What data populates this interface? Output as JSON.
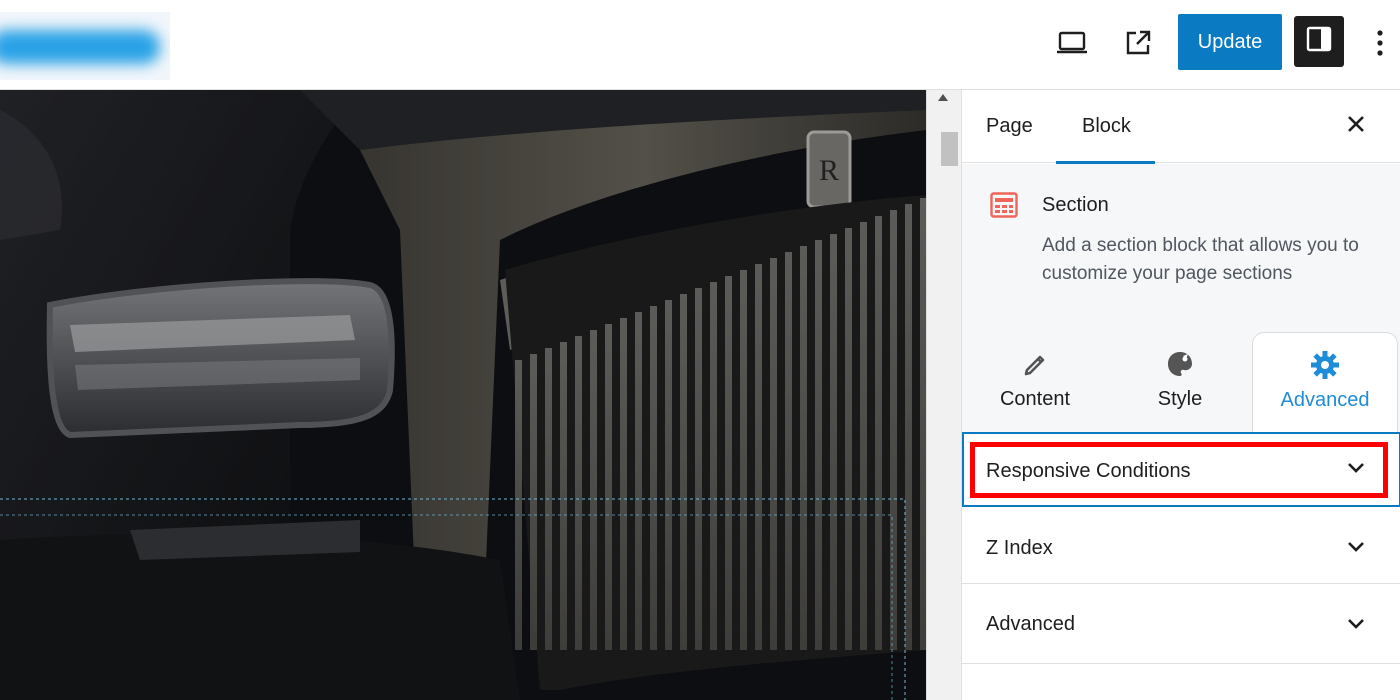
{
  "topbar": {
    "update_label": "Update",
    "icons": [
      "laptop-icon",
      "external-link-icon",
      "sidebar-toggle-icon",
      "more-vertical-icon"
    ]
  },
  "sidebar": {
    "tabs": [
      {
        "label": "Page",
        "active": false
      },
      {
        "label": "Block",
        "active": true
      }
    ],
    "block": {
      "title": "Section",
      "description": "Add a section block that allows you to customize your page sections"
    },
    "mode_tabs": [
      {
        "label": "Content",
        "icon": "pencil-icon",
        "active": false
      },
      {
        "label": "Style",
        "icon": "palette-icon",
        "active": false
      },
      {
        "label": "Advanced",
        "icon": "gear-icon",
        "active": true
      }
    ],
    "panels": [
      {
        "label": "Responsive Conditions"
      },
      {
        "label": "Z Index"
      },
      {
        "label": "Advanced"
      }
    ]
  },
  "colors": {
    "accent": "#0a7bc2",
    "active_text": "#1e8cd9",
    "highlight": "#ff0000",
    "block_icon": "#f0645a"
  }
}
